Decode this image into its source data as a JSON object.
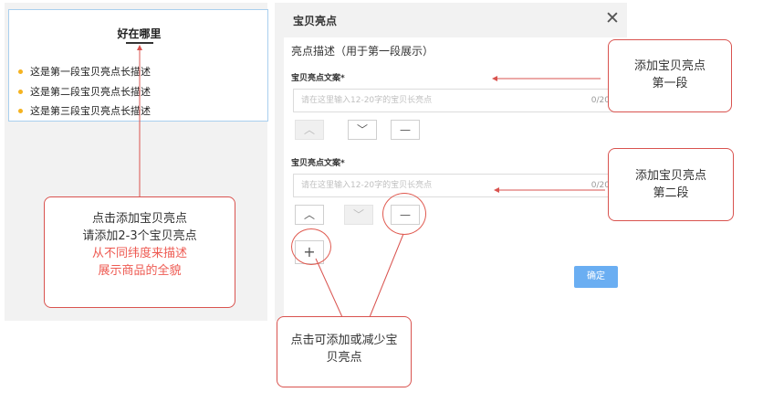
{
  "preview": {
    "title": "好在哪里",
    "bullets": [
      "这是第一段宝贝亮点长描述",
      "这是第二段宝贝亮点长描述",
      "这是第三段宝贝亮点长描述"
    ]
  },
  "dialog": {
    "title": "宝贝亮点",
    "close_icon": "close-icon",
    "section_title": "亮点描述（用于第一段展示）",
    "fields": [
      {
        "label": "宝贝亮点文案*",
        "placeholder": "请在这里输入12-20字的宝贝长亮点",
        "counter": "0/20"
      },
      {
        "label": "宝贝亮点文案*",
        "placeholder": "请在这里输入12-20字的宝贝长亮点",
        "counter": "0/20"
      }
    ],
    "up_icon": "chevron-up-icon",
    "down_icon": "chevron-down-icon",
    "remove_icon": "minus-icon",
    "add_icon": "plus-icon",
    "confirm_label": "确定",
    "accent_color": "#6aaef2"
  },
  "callouts": {
    "left_line1": "点击添加宝贝亮点",
    "left_line2": "请添加2-3个宝贝亮点",
    "left_line3": "从不同纬度来描述",
    "left_line4": "展示商品的全貌",
    "first_line1": "添加宝贝亮点",
    "first_line2": "第一段",
    "second_line1": "添加宝贝亮点",
    "second_line2": "第二段",
    "bottom_line1": "点击可添加或减少宝",
    "bottom_line2": "贝亮点",
    "annotation_color": "#e05a50"
  }
}
